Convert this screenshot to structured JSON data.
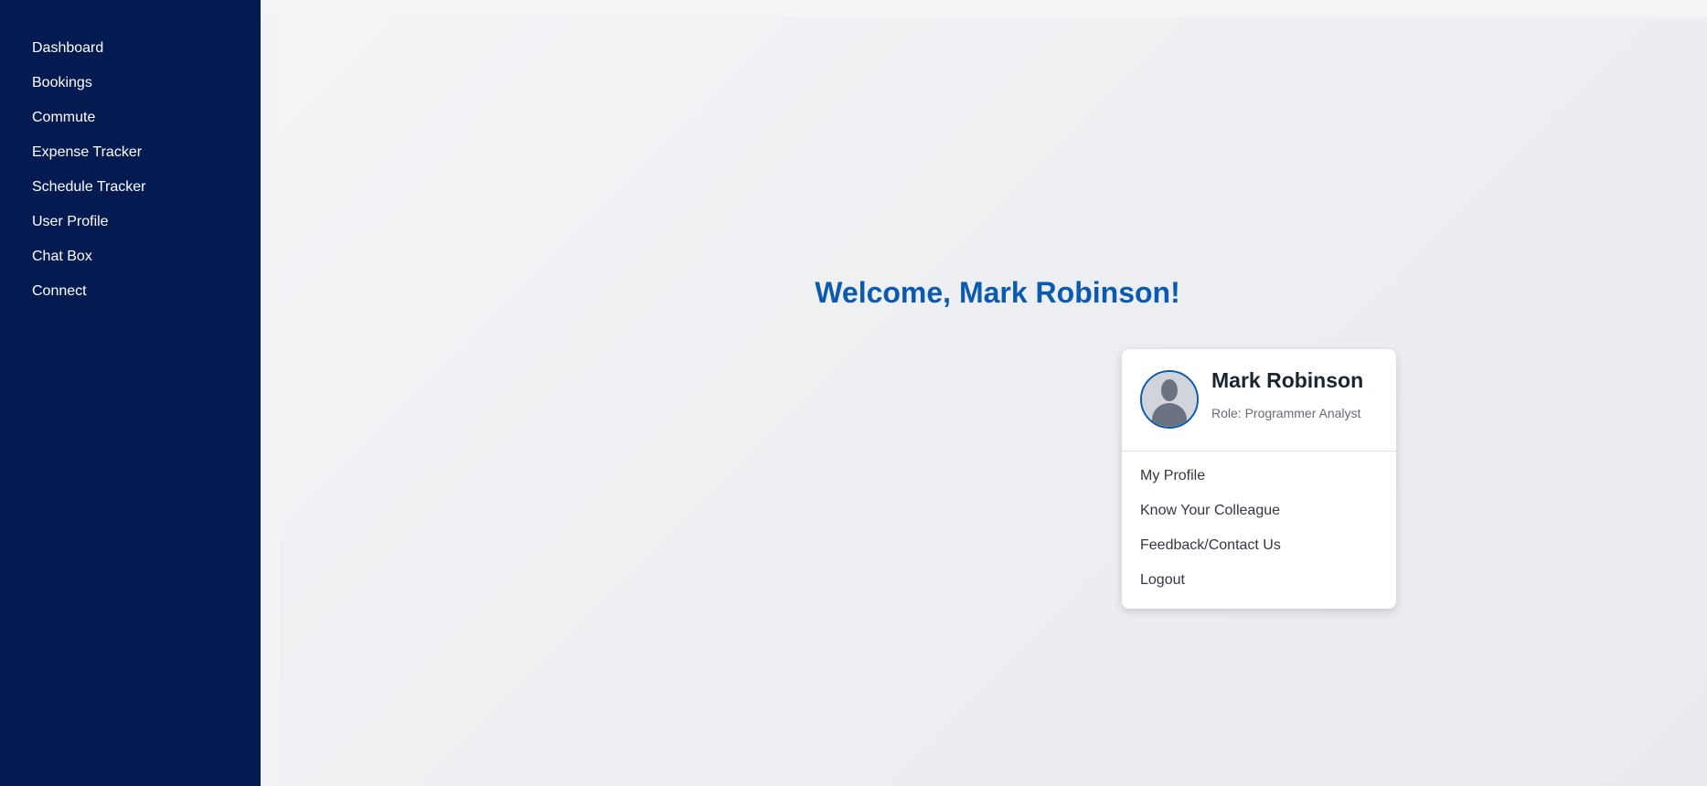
{
  "sidebar": {
    "items": [
      {
        "label": "Dashboard"
      },
      {
        "label": "Bookings"
      },
      {
        "label": "Commute"
      },
      {
        "label": "Expense Tracker"
      },
      {
        "label": "Schedule Tracker"
      },
      {
        "label": "User Profile"
      },
      {
        "label": "Chat Box"
      },
      {
        "label": "Connect"
      }
    ]
  },
  "main": {
    "welcome": "Welcome, Mark Robinson!"
  },
  "profile_card": {
    "name": "Mark Robinson",
    "role": "Role: Programmer Analyst",
    "avatar_icon": "user-avatar-icon",
    "menu": [
      {
        "label": "My Profile"
      },
      {
        "label": "Know Your Colleague"
      },
      {
        "label": "Feedback/Contact Us"
      },
      {
        "label": "Logout"
      }
    ]
  },
  "colors": {
    "sidebar_bg": "#031b51",
    "accent": "#0b5ab0",
    "page_bg": "#f1f2f4",
    "card_bg": "#ffffff"
  }
}
